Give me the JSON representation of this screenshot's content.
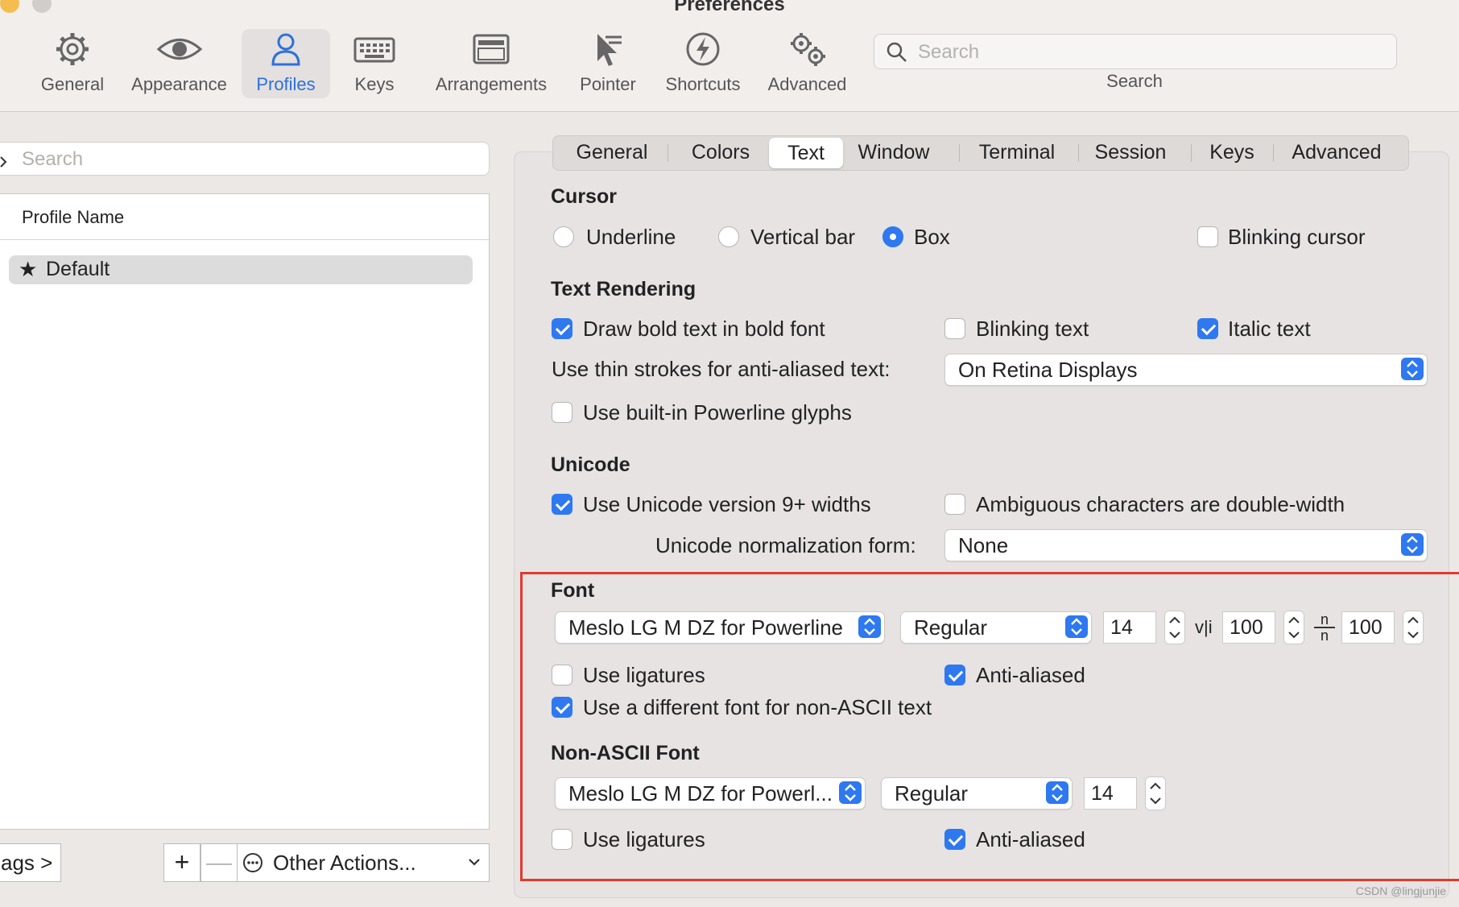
{
  "window": {
    "title": "Preferences"
  },
  "toolbar": {
    "items": [
      {
        "label": "General",
        "icon": "gear-icon"
      },
      {
        "label": "Appearance",
        "icon": "eye-icon"
      },
      {
        "label": "Profiles",
        "icon": "person-icon"
      },
      {
        "label": "Keys",
        "icon": "keyboard-icon"
      },
      {
        "label": "Arrangements",
        "icon": "window-icon"
      },
      {
        "label": "Pointer",
        "icon": "pointer-icon"
      },
      {
        "label": "Shortcuts",
        "icon": "lightning-icon"
      },
      {
        "label": "Advanced",
        "icon": "gears-icon"
      }
    ],
    "search_placeholder": "Search",
    "search_label": "Search",
    "active_color": "#2d70d9"
  },
  "profiles": {
    "search_placeholder": "Search",
    "column_header": "Profile Name",
    "rows": [
      {
        "name": "Default",
        "icon": "star-icon"
      }
    ],
    "tags_button": "ags >",
    "add_button": "+",
    "remove_button": "—",
    "other_actions": "Other Actions..."
  },
  "tabs": [
    "General",
    "Colors",
    "Text",
    "Window",
    "Terminal",
    "Session",
    "Keys",
    "Advanced"
  ],
  "active_tab": "Text",
  "cursor": {
    "heading": "Cursor",
    "underline": "Underline",
    "vertical_bar": "Vertical bar",
    "box": "Box",
    "selected": "Box",
    "blinking": "Blinking cursor"
  },
  "text_rendering": {
    "heading": "Text Rendering",
    "bold": "Draw bold text in bold font",
    "blinking_text": "Blinking text",
    "italic": "Italic text",
    "thin_strokes_label": "Use thin strokes for anti-aliased text:",
    "thin_strokes_value": "On Retina Displays",
    "powerline": "Use built-in Powerline glyphs"
  },
  "unicode": {
    "heading": "Unicode",
    "widths": "Use Unicode version 9+ widths",
    "ambiguous": "Ambiguous characters are double-width",
    "normalization_label": "Unicode normalization form:",
    "normalization_value": "None"
  },
  "font": {
    "heading": "Font",
    "family": "Meslo LG M DZ for Powerline",
    "style": "Regular",
    "size": "14",
    "hspacing_label": "v|i",
    "hspacing": "100",
    "vspacing_label": "n/n",
    "vspacing": "100",
    "ligatures": "Use ligatures",
    "anti_aliased": "Anti-aliased",
    "different_non_ascii": "Use a different font for non-ASCII text"
  },
  "non_ascii_font": {
    "heading": "Non-ASCII Font",
    "family": "Meslo LG M DZ for Powerl...",
    "style": "Regular",
    "size": "14",
    "ligatures": "Use ligatures",
    "anti_aliased": "Anti-aliased"
  },
  "highlight_color": "#e03a2e",
  "watermark": "CSDN @lingjunjie"
}
